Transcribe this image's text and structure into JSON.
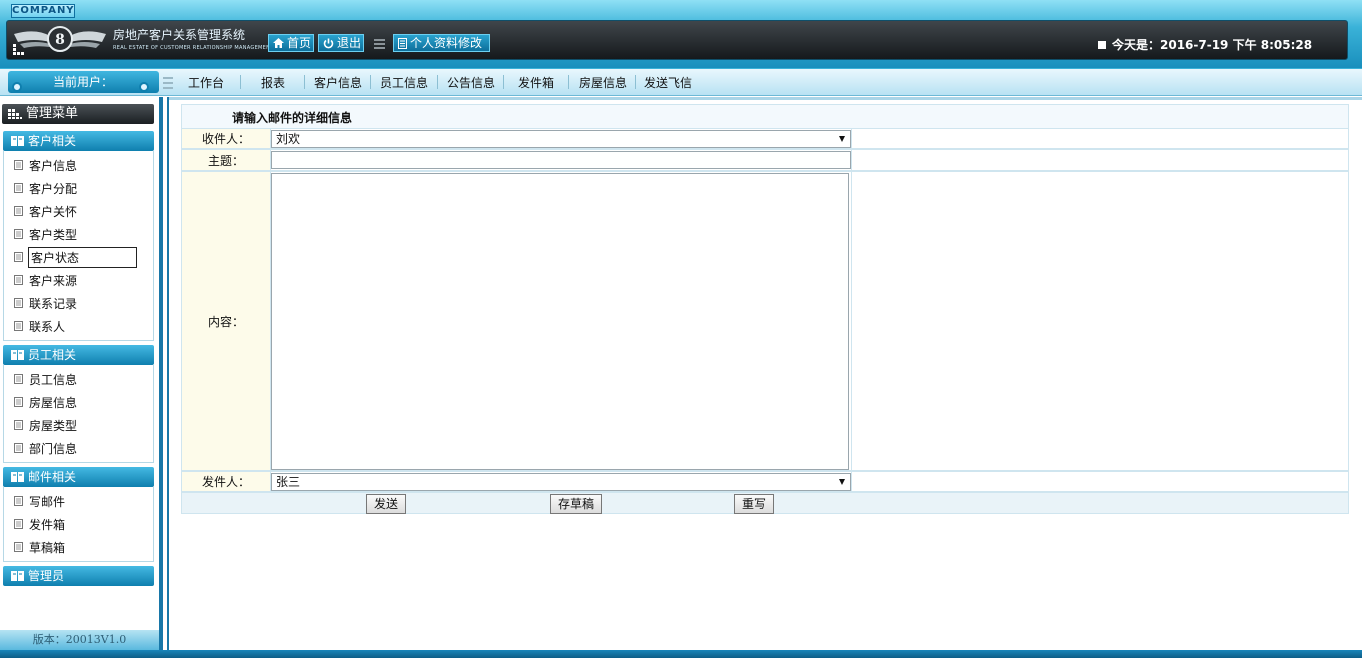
{
  "header": {
    "company_badge": "COMPANY",
    "system_title": "房地产客户关系管理系统",
    "system_subtitle": "REAL ESTATE OF CUSTOMER RELATIONSHIP MANAGEMENT SYSTEM",
    "home_label": "首页",
    "logout_label": "退出",
    "profile_label": "个人资料修改",
    "today_label": "今天是：2016-7-19 下午 8:05:28"
  },
  "navbar": {
    "current_user_label": "当前用户：",
    "items": [
      "工作台",
      "报表",
      "客户信息",
      "员工信息",
      "公告信息",
      "发件箱",
      "房屋信息",
      "发送飞信"
    ]
  },
  "sidebar": {
    "menu_title": "管理菜单",
    "groups": [
      {
        "title": "客户相关",
        "items": [
          "客户信息",
          "客户分配",
          "客户关怀",
          "客户类型",
          "客户状态",
          "客户来源",
          "联系记录",
          "联系人"
        ]
      },
      {
        "title": "员工相关",
        "items": [
          "员工信息",
          "房屋信息",
          "房屋类型",
          "部门信息"
        ]
      },
      {
        "title": "邮件相关",
        "items": [
          "写邮件",
          "发件箱",
          "草稿箱"
        ]
      },
      {
        "title": "管理员",
        "items": []
      }
    ],
    "selected_item": "客户状态",
    "version": "版本：20013V1.0"
  },
  "form": {
    "title": "请输入邮件的详细信息",
    "recipient_label": "收件人：",
    "recipient_value": "刘欢",
    "subject_label": "主题：",
    "subject_value": "",
    "content_label": "内容：",
    "content_value": "",
    "sender_label": "发件人：",
    "sender_value": "张三",
    "send_button": "发送",
    "draft_button": "存草稿",
    "reset_button": "重写"
  },
  "colors": {
    "header_blue": "#198fbd",
    "header_dark": "#15191c",
    "nav_bg": "#e9f7fd",
    "group_blue": "#0f7fae",
    "label_bg": "#fdfbea",
    "frame_border": "#1877a8"
  }
}
